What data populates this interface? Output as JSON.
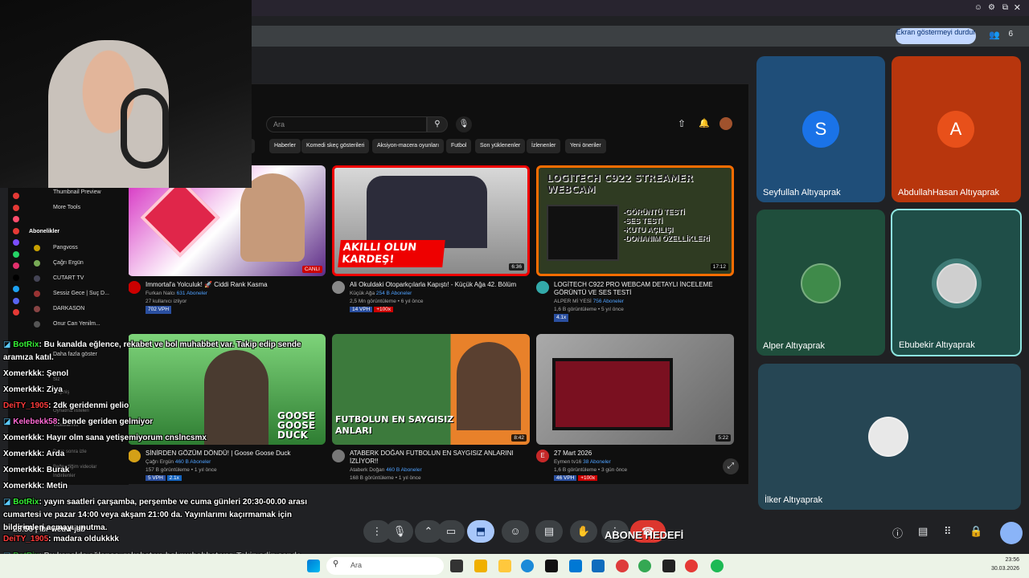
{
  "meet": {
    "stop_share_label": "Ekran göstermeyi durdur",
    "people_count": "6",
    "meeting_time": "23:56",
    "meeting_code": "ibr-weuw-jdb",
    "participants": [
      {
        "name": "Seyfullah Altıyaprak",
        "initial": "S",
        "color": "#1a73e8"
      },
      {
        "name": "AbdullahHasan Altıyaprak",
        "initial": "A",
        "color": "#e8501a"
      },
      {
        "name": "Alper Altıyaprak"
      },
      {
        "name": "Ebubekir Altıyaprak"
      },
      {
        "name": "İlker Altıyaprak"
      }
    ],
    "subscribe_goal": "ABONE HEDEFİ"
  },
  "youtube": {
    "search_placeholder": "Ara",
    "chips": [
      "er",
      "Haberler",
      "Komedi skeç gösterileri",
      "Aksiyon-macera oyunları",
      "Futbol",
      "Son yüklenenler",
      "İzlenenler",
      "Yeni öneriler"
    ],
    "sidebar": {
      "top": [
        "Thumbnail Preview",
        "More Tools"
      ],
      "subs_header": "Abonelikler",
      "subs": [
        "Pangvoss",
        "Çağrı Ergün",
        "CUTART TV",
        "Sessiz Gece | Suç D...",
        "DARKASON",
        "Onur Can Yenilm..."
      ],
      "more": "Daha fazla göster",
      "faded": [
        "Siz",
        "Geçmiş",
        "Oynatma listeleri",
        "Videolarınız",
        "Daha sonra izle",
        "Beğendiğim videolar",
        "İndirilenler"
      ]
    },
    "videos": [
      {
        "title": "Immortal'a Yolculuk! 🚀 Ciddi Rank Kasma",
        "channel": "Furkan Nalcı",
        "subs": "631 Aboneler",
        "meta": "27 kullanıcı izliyor",
        "badge": "702 VPH",
        "live": "CANLI"
      },
      {
        "title": "Ali Okuldaki Otoparkçılarla Kapıştı! - Küçük Ağa 42. Bölüm",
        "channel": "Küçük Ağa",
        "subs": "254 B Aboneler",
        "meta": "2,5 Mn görüntüleme • 6 yıl önce",
        "badge": "14 VPH",
        "badge2": "+100x",
        "duration": "6:36",
        "thumb_text": "AKILLI OLUN KARDEŞ!"
      },
      {
        "title": "LOGİTECH C922 PRO WEBCAM DETAYLI İNCELEME GÖRÜNTÜ VE SES TESTİ",
        "channel": "ALPER Mİ YESİ",
        "subs": "756 Aboneler",
        "meta": "1,6 B görüntüleme • 5 yıl önce",
        "badge": "4.1x",
        "duration": "17:12",
        "thumb_text": "LOGITECH C922 STREAMER WEBCAM",
        "thumb_lines": [
          "-GÖRÜNTÜ TESTİ",
          "-SES TESTİ",
          "-KUTU AÇILIŞI",
          "-DONANIM ÖZELLİKLERİ"
        ]
      },
      {
        "title": "SİNİRDEN GÖZÜM DÖNDÜ! | Goose Goose Duck",
        "channel": "Çağrı Ergün",
        "subs": "460 B Aboneler",
        "meta": "157 B görüntüleme • 1 yıl önce",
        "badge": "5 VPH",
        "badge2": "2.1x",
        "thumb_text": "GOOSE GOOSE DUCK"
      },
      {
        "title": "ATABERK DOĞAN FUTBOLUN EN SAYGISIZ ANLARINI İZLİYOR!!",
        "channel": "Ataberk Doğan",
        "subs": "460 B Aboneler",
        "meta": "168 B görüntüleme • 1 yıl önce",
        "duration": "8:42",
        "thumb_text": "FUTBOLUN EN SAYGISIZ ANLARI"
      },
      {
        "title": "27 Mart 2026",
        "channel": "Eymen tv16",
        "subs": "38 Aboneler",
        "meta": "1,6 B görüntüleme • 3 gün önce",
        "badge": "46 VPH",
        "badge2": "+100x",
        "duration": "5:22"
      }
    ]
  },
  "chat": [
    {
      "user": "BotRix",
      "bot": true,
      "text": ": Bu kanalda eğlence, rekabet ve bol muhabbet var. Takip edip sende aramıza katıl."
    },
    {
      "user": "Xomerkkk",
      "text": ": Şenol"
    },
    {
      "user": "Xomerkkk",
      "text": ": Ziya"
    },
    {
      "user": "DeiTY_1905",
      "text": ": 2dk geridenmi gelio"
    },
    {
      "user": "Kelebekk58",
      "bot": true,
      "text": ": bende geriden gelmiyor"
    },
    {
      "user": "Xomerkkk",
      "text": ": Hayır olm sana yetişemiyorum cnslncsmx"
    },
    {
      "user": "Xomerkkk",
      "text": ": Arda"
    },
    {
      "user": "Xomerkkk",
      "text": ": Burak"
    },
    {
      "user": "Xomerkkk",
      "text": ": Metin"
    },
    {
      "user": "BotRix",
      "bot": true,
      "text": ": yayın saatleri çarşamba, perşembe ve cuma günleri 20:30-00.00 arası cumartesi ve pazar 14:00 veya akşam 21:00 da. Yayınlarımı kaçırmamak için bildirimleri açmayı unutma."
    },
    {
      "user": "DeiTY_1905",
      "text": ": madara oldukkkk"
    },
    {
      "user": "BotRix",
      "bot": true,
      "text": ": Bu kanalda eğlence, rekabet ve bol muhabbet var. Takip edip sende aramıza katıl."
    }
  ],
  "taskbar": {
    "search_placeholder": "Ara",
    "time": "23:56",
    "date": "30.03.2026"
  },
  "colors": {
    "accent": "#1a73e8",
    "bot": "#35f035",
    "xomer": "#ffffff",
    "deity": "#ff3b3b",
    "kelebek": "#ff6ad5"
  }
}
